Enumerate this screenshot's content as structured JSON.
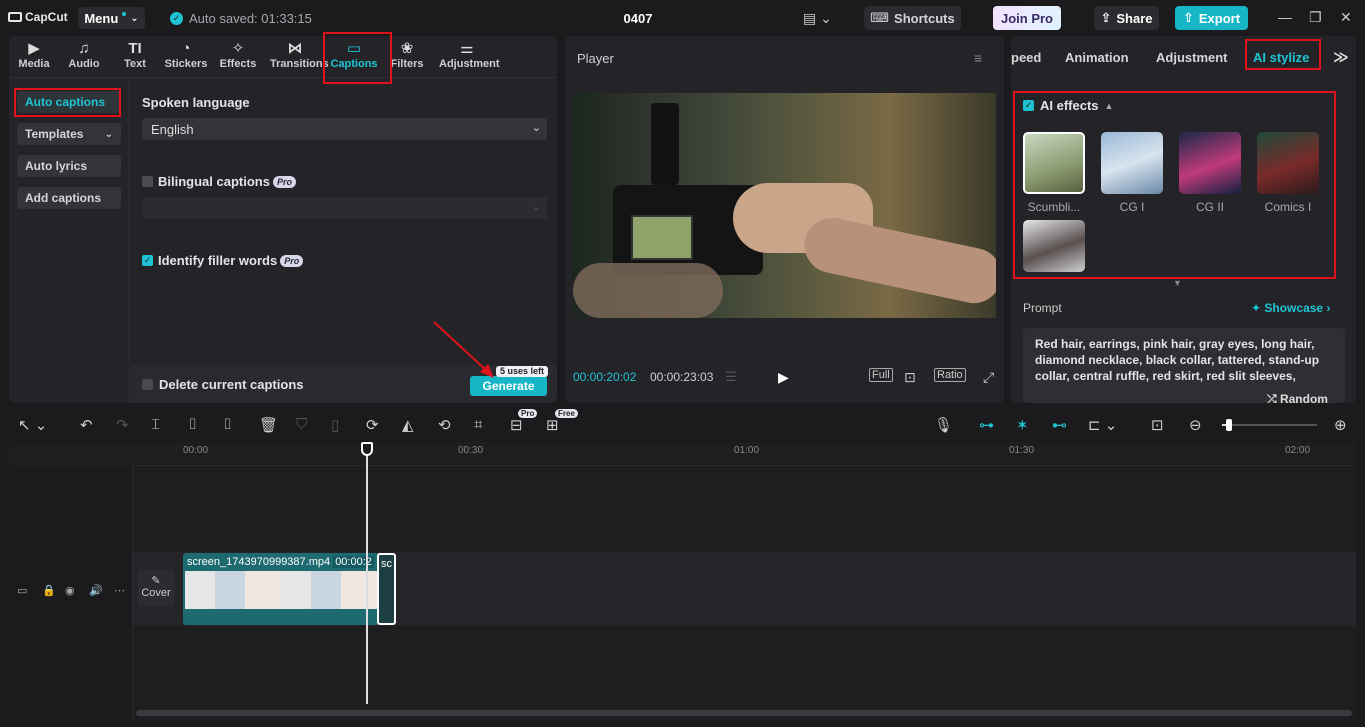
{
  "app": {
    "brand": "CapCut",
    "menu_label": "Menu",
    "autosave": "Auto saved: 01:33:15",
    "project_title": "0407"
  },
  "titlebar": {
    "shortcuts": "Shortcuts",
    "join_pro": "Join Pro",
    "share": "Share",
    "export": "Export"
  },
  "tabs": [
    {
      "icon": "media-icon",
      "label": "Media"
    },
    {
      "icon": "audio-icon",
      "label": "Audio"
    },
    {
      "icon": "text-icon",
      "label": "Text"
    },
    {
      "icon": "stickers-icon",
      "label": "Stickers"
    },
    {
      "icon": "effects-icon",
      "label": "Effects"
    },
    {
      "icon": "transitions-icon",
      "label": "Transitions"
    },
    {
      "icon": "captions-icon",
      "label": "Captions"
    },
    {
      "icon": "filters-icon",
      "label": "Filters"
    },
    {
      "icon": "adjustment-icon",
      "label": "Adjustment"
    }
  ],
  "captions_side": [
    {
      "label": "Auto captions"
    },
    {
      "label": "Templates"
    },
    {
      "label": "Auto lyrics"
    },
    {
      "label": "Add captions"
    }
  ],
  "captions": {
    "spoken_language_label": "Spoken language",
    "spoken_language_value": "English",
    "bilingual_label": "Bilingual captions",
    "pro_badge": "Pro",
    "filler_label": "Identify filler words",
    "delete_label": "Delete current captions",
    "generate": "Generate",
    "uses_left": "5 uses left"
  },
  "player": {
    "title": "Player",
    "current_time": "00:00:20:02",
    "total_time": "00:00:23:03",
    "full": "Full",
    "ratio": "Ratio"
  },
  "right_tabs": [
    {
      "label": "peed"
    },
    {
      "label": "Animation"
    },
    {
      "label": "Adjustment"
    },
    {
      "label": "AI stylize"
    }
  ],
  "ai": {
    "title": "AI effects",
    "effects": [
      {
        "label": "Scumbli..."
      },
      {
        "label": "CG I"
      },
      {
        "label": "CG II"
      },
      {
        "label": "Comics I"
      },
      {
        "label": ""
      }
    ],
    "prompt_label": "Prompt",
    "showcase": "Showcase",
    "prompt_text": "Red hair, earrings, pink hair, gray eyes, long hair, diamond necklace, black collar, tattered, stand-up collar, central ruffle, red skirt, red slit sleeves,",
    "random": "Random"
  },
  "timeline": {
    "ticks": [
      "00:00",
      "00:30",
      "01:00",
      "01:30",
      "02:00"
    ],
    "clip_name": "screen_1743970999387.mp4",
    "clip_duration": "00:00:2",
    "clip2_name": "sc",
    "cover": "Cover",
    "pro_badge": "Pro",
    "free_badge": "Free"
  },
  "colors": {
    "accent": "#1fc4d4",
    "highlight": "#e0121b",
    "export": "#17b6c6"
  }
}
